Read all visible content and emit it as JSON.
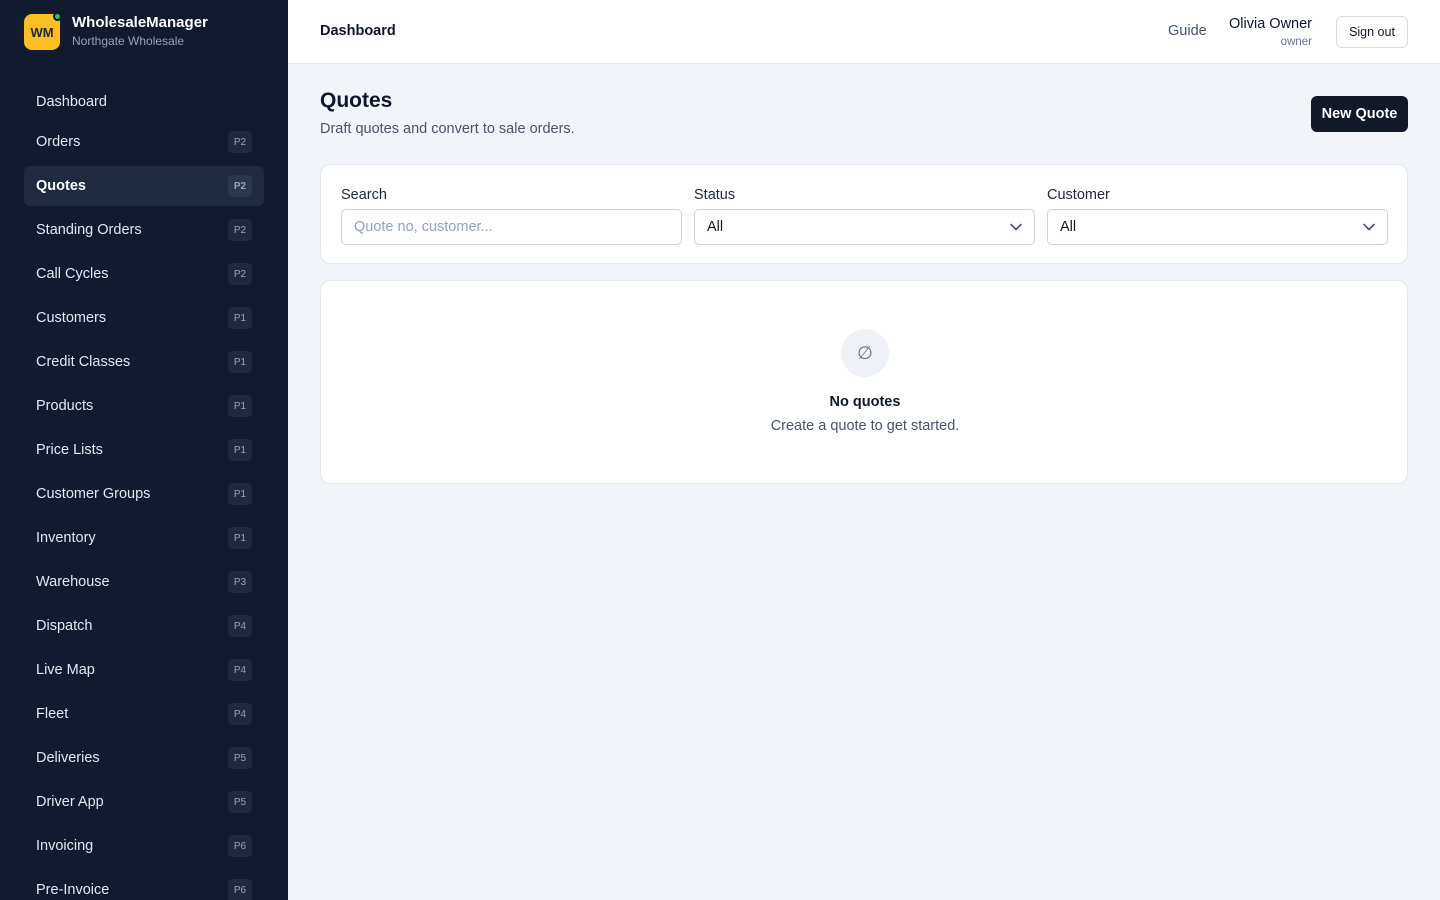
{
  "brand": {
    "logo_text": "WM",
    "name": "WholesaleManager",
    "org": "Northgate Wholesale"
  },
  "sidebar": {
    "items": [
      {
        "label": "Dashboard",
        "badge": ""
      },
      {
        "label": "Orders",
        "badge": "P2"
      },
      {
        "label": "Quotes",
        "badge": "P2",
        "active": true
      },
      {
        "label": "Standing Orders",
        "badge": "P2"
      },
      {
        "label": "Call Cycles",
        "badge": "P2"
      },
      {
        "label": "Customers",
        "badge": "P1"
      },
      {
        "label": "Credit Classes",
        "badge": "P1"
      },
      {
        "label": "Products",
        "badge": "P1"
      },
      {
        "label": "Price Lists",
        "badge": "P1"
      },
      {
        "label": "Customer Groups",
        "badge": "P1"
      },
      {
        "label": "Inventory",
        "badge": "P1"
      },
      {
        "label": "Warehouse",
        "badge": "P3"
      },
      {
        "label": "Dispatch",
        "badge": "P4"
      },
      {
        "label": "Live Map",
        "badge": "P4"
      },
      {
        "label": "Fleet",
        "badge": "P4"
      },
      {
        "label": "Deliveries",
        "badge": "P5"
      },
      {
        "label": "Driver App",
        "badge": "P5"
      },
      {
        "label": "Invoicing",
        "badge": "P6"
      },
      {
        "label": "Pre-Invoice",
        "badge": "P6"
      }
    ]
  },
  "header": {
    "breadcrumb": "Dashboard",
    "guide_label": "Guide",
    "user_name": "Olivia Owner",
    "user_role": "owner",
    "signout_label": "Sign out"
  },
  "main": {
    "title": "Quotes",
    "subtitle": "Draft quotes and convert to sale orders.",
    "new_button_label": "New Quote",
    "filters": {
      "search_label": "Search",
      "search_placeholder": "Quote no, customer...",
      "status_label": "Status",
      "status_value": "All",
      "customer_label": "Customer",
      "customer_value": "All"
    },
    "empty": {
      "icon": "∅",
      "title": "No quotes",
      "message": "Create a quote to get started."
    }
  },
  "colors": {
    "sidebar_bg": "#111a2e",
    "logo_bg": "#fbbf24",
    "primary_button": "#111827",
    "status_dot": "#22c55e"
  }
}
